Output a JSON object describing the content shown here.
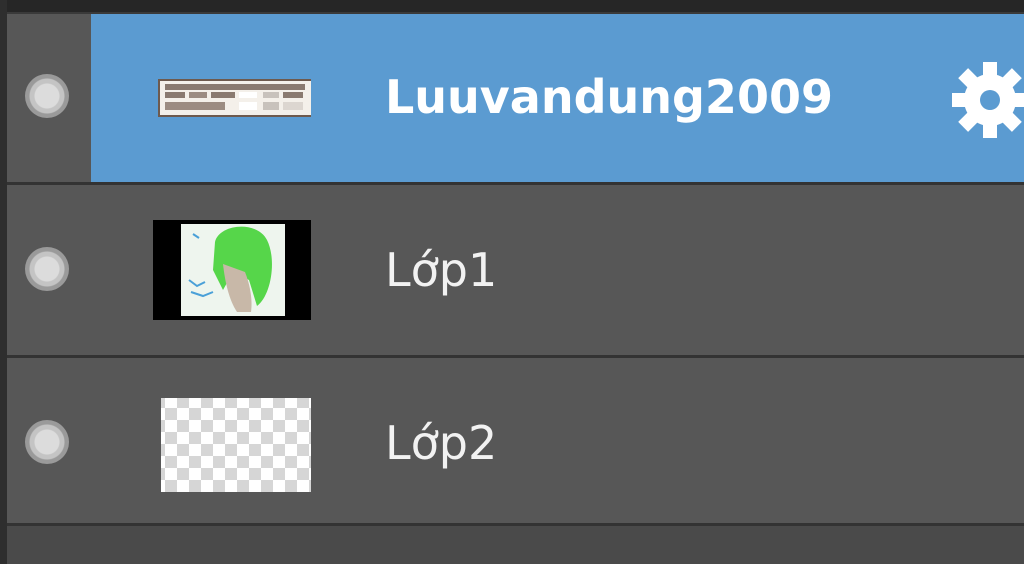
{
  "layers_panel": {
    "layers": [
      {
        "name": "Luuvandung2009",
        "selected": true,
        "thumbnail": "text-banner-thumbnail"
      },
      {
        "name": "Lớp1",
        "selected": false,
        "thumbnail": "green-hair-character-thumbnail"
      },
      {
        "name": "Lớp2",
        "selected": false,
        "thumbnail": "transparent-checker-thumbnail"
      }
    ],
    "settings_icon": "gear-icon",
    "visibility_icon": "visibility-dot-icon",
    "colors": {
      "selected_row": "#5b9bd1",
      "row_bg": "#575757",
      "text": "#f2f2f2"
    }
  }
}
